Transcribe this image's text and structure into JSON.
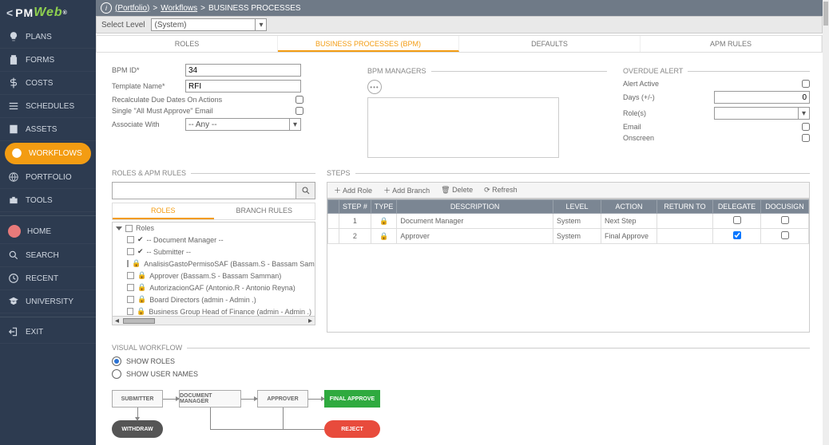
{
  "sidebar": {
    "logo_text": "PMWeb",
    "items": [
      {
        "label": "PLANS",
        "icon": "bulb"
      },
      {
        "label": "FORMS",
        "icon": "clipboard"
      },
      {
        "label": "COSTS",
        "icon": "dollar"
      },
      {
        "label": "SCHEDULES",
        "icon": "bars"
      },
      {
        "label": "ASSETS",
        "icon": "building"
      },
      {
        "label": "WORKFLOWS",
        "icon": "check",
        "active": true
      },
      {
        "label": "PORTFOLIO",
        "icon": "globe"
      },
      {
        "label": "TOOLS",
        "icon": "briefcase"
      }
    ],
    "lower": [
      {
        "label": "HOME",
        "icon": "avatar"
      },
      {
        "label": "SEARCH",
        "icon": "search"
      },
      {
        "label": "RECENT",
        "icon": "history"
      },
      {
        "label": "UNIVERSITY",
        "icon": "grad"
      },
      {
        "label": "EXIT",
        "icon": "exit"
      }
    ]
  },
  "breadcrumb": {
    "info": "i",
    "portfolio": "(Portfolio)",
    "sep": " > ",
    "workflows": "Workflows",
    "bp": "BUSINESS PROCESSES"
  },
  "levelbar": {
    "label": "Select Level",
    "value": "(System)"
  },
  "stage_tabs": [
    "ROLES",
    "BUSINESS PROCESSES (BPM)",
    "DEFAULTS",
    "APM RULES"
  ],
  "stage_active": 1,
  "form": {
    "bpm_id_label": "BPM ID*",
    "bpm_id_value": "34",
    "template_label": "Template Name*",
    "template_value": "RFI",
    "recalc_label": "Recalculate Due Dates On Actions",
    "single_label": "Single \"All Must Approve\" Email",
    "assoc_label": "Associate With",
    "assoc_value": "-- Any --"
  },
  "bpm_managers_title": "BPM MANAGERS",
  "overdue": {
    "title": "OVERDUE ALERT",
    "alert_active_label": "Alert Active",
    "days_label": "Days (+/-)",
    "days_value": "0",
    "roles_label": "Role(s)",
    "email_label": "Email",
    "onscreen_label": "Onscreen"
  },
  "roles_section_title": "ROLES & APM RULES",
  "steps_section_title": "STEPS",
  "sub_tabs": [
    "ROLES",
    "BRANCH RULES"
  ],
  "tree": {
    "root": "Roles",
    "rows": [
      "-- Document Manager --",
      "-- Submitter --",
      "AnalisisGastoPermisoSAF (Bassam.S - Bassam Sam",
      "Approver (Bassam.S - Bassam Samman)",
      "AutorizacionGAF (Antonio.R - Antonio Reyna)",
      "Board Directors (admin - Admin .)",
      "Business Group Head of Finance (admin - Admin .)"
    ]
  },
  "steps_toolbar": {
    "add_role": "Add Role",
    "add_branch": "Add Branch",
    "delete": "Delete",
    "refresh": "Refresh"
  },
  "steps_table": {
    "headers": [
      "STEP #",
      "TYPE",
      "DESCRIPTION",
      "LEVEL",
      "ACTION",
      "RETURN TO",
      "DELEGATE",
      "DOCUSIGN"
    ],
    "rows": [
      {
        "step": "1",
        "type": "lock",
        "desc": "Document Manager",
        "level": "System",
        "action": "Next Step",
        "return": "",
        "delegate": false,
        "docusign": false
      },
      {
        "step": "2",
        "type": "lock",
        "desc": "Approver",
        "level": "System",
        "action": "Final Approve",
        "return": "",
        "delegate": true,
        "docusign": false
      }
    ]
  },
  "visual_title": "VISUAL WORKFLOW",
  "visual": {
    "show_roles": "SHOW ROLES",
    "show_users": "SHOW USER NAMES"
  },
  "flow": {
    "submitter": "SUBMITTER",
    "doc_mgr": "DOCUMENT MANAGER",
    "approver": "APPROVER",
    "final": "FINAL APPROVE",
    "withdraw": "WITHDRAW",
    "reject": "REJECT"
  }
}
